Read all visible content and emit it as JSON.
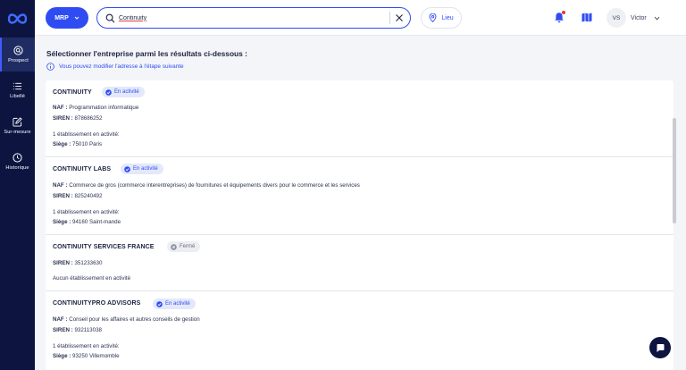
{
  "sidebar": {
    "items": [
      {
        "label": "Prospect",
        "icon": "prospect-icon",
        "active": true
      },
      {
        "label": "Libellé",
        "icon": "list-icon",
        "active": false
      },
      {
        "label": "Sur-mesure",
        "icon": "edit-icon",
        "active": false
      },
      {
        "label": "Historique",
        "icon": "clock-icon",
        "active": false
      }
    ]
  },
  "topbar": {
    "mrp_label": "MRP",
    "search_value": "Continuity",
    "lieu_label": "Lieu",
    "user_initials": "VS",
    "user_name": "Victor"
  },
  "main": {
    "title": "Sélectionner l'entreprise parmi les résultats ci-dessous :",
    "info": "Vous pouvez modifier l'adresse à l'étape suivante"
  },
  "results": [
    {
      "name": "CONTINUITY",
      "status": "En activité",
      "naf_label": "NAF :",
      "naf": "Programmation informatique",
      "siren_label": "SIREN :",
      "siren": "878686252",
      "etab": "1 établissement en activité:",
      "siege_label": "Siège :",
      "siege": "75010 Paris"
    },
    {
      "name": "CONTINUITY LABS",
      "status": "En activité",
      "naf_label": "NAF :",
      "naf": "Commerce de gros (commerce interentreprises) de fournitures et équipements divers pour le commerce et les services",
      "siren_label": "SIREN :",
      "siren": "825240492",
      "etab": "1 établissement en activité:",
      "siege_label": "Siège :",
      "siege": "94160 Saint-mande"
    },
    {
      "name": "CONTINUITY SERVICES FRANCE",
      "status": "Fermé",
      "siren_label": "SIREN :",
      "siren": "351233630",
      "etab": "Aucun établissement en activité"
    },
    {
      "name": "CONTINUITYPRO ADVISORS",
      "status": "En activité",
      "naf_label": "NAF :",
      "naf": "Conseil pour les affaires et autres conseils de gestion",
      "siren_label": "SIREN :",
      "siren": "932113038",
      "etab": "1 établissement en activité:",
      "siege_label": "Siège :",
      "siege": "93250 Villemomble"
    }
  ],
  "colors": {
    "sidebar": "#0d1440",
    "accent": "#2f4cf2",
    "active_badge_bg": "#e4e8fb",
    "closed_badge_bg": "#eceef2"
  }
}
